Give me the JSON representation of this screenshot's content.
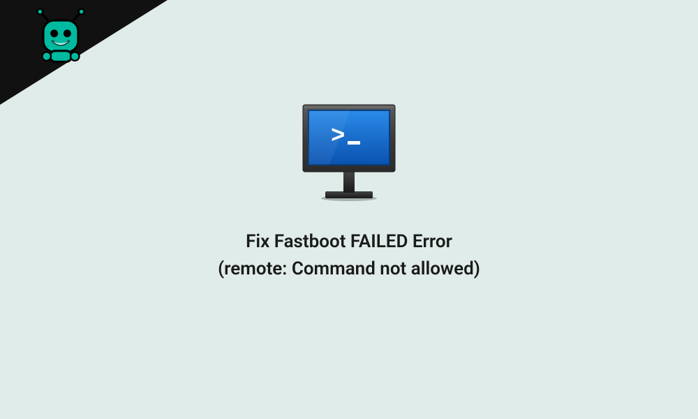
{
  "background_color": "#e0ecea",
  "corner": {
    "triangle_color": "#111111",
    "robot": {
      "body_color": "#00ba9f",
      "eye_color": "#000000",
      "mouth_color": "#cceee8",
      "body_outline": "#000000"
    }
  },
  "monitor": {
    "bezel_color": "#3b3b3b",
    "bezel_highlight": "#5a5a5a",
    "screen_color_top": "#1e7ddc",
    "screen_color_bottom": "#0b5cbf",
    "prompt_text": ">_",
    "prompt_color": "#ffffff",
    "stand_color": "#2a2a2a"
  },
  "headline": {
    "line1": "Fix Fastboot FAILED Error",
    "line2": "(remote: Command not allowed)"
  }
}
